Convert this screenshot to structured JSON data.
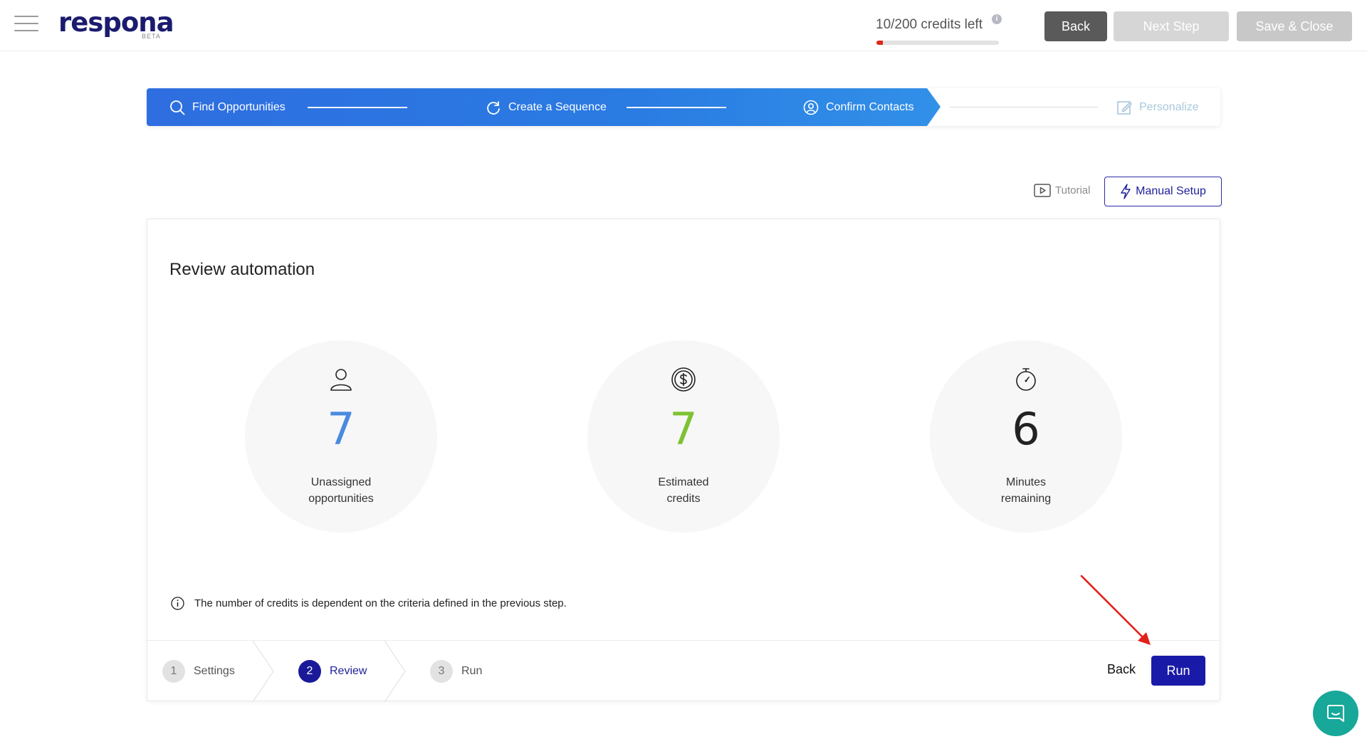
{
  "header": {
    "logo": "respona",
    "logo_badge": "BETA",
    "credits_text": "10/200 credits left",
    "credits_info": "i",
    "credits_progress": 0.05,
    "back_label": "Back",
    "next_label": "Next Step",
    "save_label": "Save & Close"
  },
  "stepper": {
    "steps": [
      {
        "label": "Find Opportunities",
        "icon": "search-icon",
        "state": "done"
      },
      {
        "label": "Create a Sequence",
        "icon": "refresh-icon",
        "state": "done"
      },
      {
        "label": "Confirm Contacts",
        "icon": "user-circle-icon",
        "state": "current"
      },
      {
        "label": "Personalize",
        "icon": "edit-icon",
        "state": "upcoming"
      }
    ]
  },
  "toolbar": {
    "tutorial_label": "Tutorial",
    "manual_label": "Manual Setup"
  },
  "review": {
    "title": "Review automation",
    "stats": [
      {
        "value": "7",
        "label_line1": "Unassigned",
        "label_line2": "opportunities",
        "icon": "user-icon",
        "color": "#4a8ae0"
      },
      {
        "value": "7",
        "label_line1": "Estimated",
        "label_line2": "credits",
        "icon": "dollar-coin-icon",
        "color": "#7ec232"
      },
      {
        "value": "6",
        "label_line1": "Minutes",
        "label_line2": "remaining",
        "icon": "stopwatch-icon",
        "color": "#222222"
      }
    ],
    "note": "The number of credits is dependent on the criteria defined in the previous step."
  },
  "wizard": {
    "steps": [
      {
        "num": "1",
        "label": "Settings"
      },
      {
        "num": "2",
        "label": "Review"
      },
      {
        "num": "3",
        "label": "Run"
      }
    ],
    "active_step": 2,
    "back_label": "Back",
    "run_label": "Run"
  },
  "colors": {
    "accent": "#1a1aa8",
    "stepper_blue": "#2e6ee0",
    "credits_bar": "#e0271a",
    "chat": "#17a89a",
    "annotation_arrow": "#e3211b"
  }
}
